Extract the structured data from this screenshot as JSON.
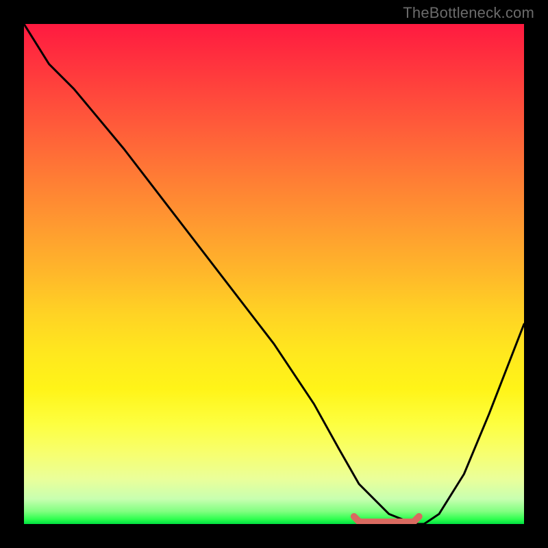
{
  "watermark": "TheBottleneck.com",
  "chart_data": {
    "type": "line",
    "title": "",
    "xlabel": "",
    "ylabel": "",
    "xlim": [
      0,
      1
    ],
    "ylim": [
      0,
      1
    ],
    "grid": false,
    "legend": false,
    "series": [
      {
        "name": "bottleneck-curve",
        "color": "#000000",
        "x": [
          0.0,
          0.05,
          0.1,
          0.2,
          0.3,
          0.4,
          0.5,
          0.58,
          0.63,
          0.67,
          0.73,
          0.78,
          0.8,
          0.83,
          0.88,
          0.93,
          1.0
        ],
        "values": [
          1.0,
          0.92,
          0.87,
          0.75,
          0.62,
          0.49,
          0.36,
          0.24,
          0.15,
          0.08,
          0.02,
          0.0,
          0.0,
          0.02,
          0.1,
          0.22,
          0.4
        ]
      }
    ],
    "marker_band": {
      "name": "valley-marker",
      "color": "#d96a60",
      "x_start": 0.66,
      "x_end": 0.79,
      "y": 0.0
    },
    "gradient_stops": [
      {
        "pos": 0.0,
        "color": "#ff1a40"
      },
      {
        "pos": 0.5,
        "color": "#ffb82a"
      },
      {
        "pos": 0.8,
        "color": "#fdff40"
      },
      {
        "pos": 1.0,
        "color": "#00e040"
      }
    ]
  }
}
